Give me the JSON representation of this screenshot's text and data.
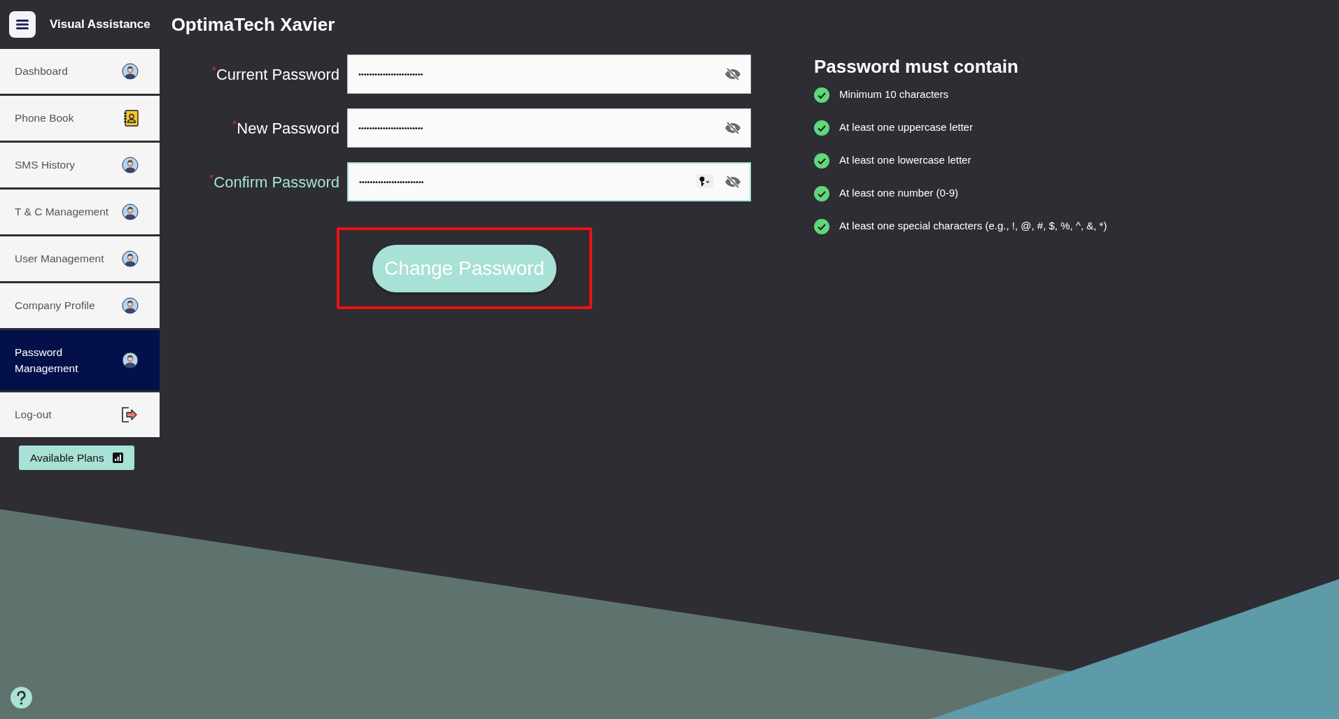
{
  "header": {
    "app_name": "Visual Assistance",
    "company": "OptimaTech Xavier"
  },
  "sidebar": {
    "items": [
      {
        "label": "Dashboard",
        "kind": "avatar",
        "selected": false
      },
      {
        "label": "Phone Book",
        "kind": "contacts",
        "selected": false
      },
      {
        "label": "SMS History",
        "kind": "avatar",
        "selected": false
      },
      {
        "label": "T & C Management",
        "kind": "avatar",
        "selected": false
      },
      {
        "label": "User Management",
        "kind": "avatar",
        "selected": false
      },
      {
        "label": "Company Profile",
        "kind": "avatar",
        "selected": false
      },
      {
        "label": "Password Management",
        "kind": "avatar",
        "selected": true
      },
      {
        "label": "Log-out",
        "kind": "logout",
        "selected": false
      }
    ],
    "plans_button": "Available Plans"
  },
  "form": {
    "fields": [
      {
        "required_mark": "*",
        "label": "Current Password",
        "value": "••••••••••••••••••••••••",
        "focused": false,
        "autofill_key": false
      },
      {
        "required_mark": "*",
        "label": "New Password",
        "value": "••••••••••••••••••••••••",
        "focused": false,
        "autofill_key": false
      },
      {
        "required_mark": "*",
        "label": "Confirm Password",
        "value": "••••••••••••••••••••••••",
        "focused": true,
        "autofill_key": true
      }
    ],
    "submit": {
      "label": "Change Password",
      "highlighted": true
    }
  },
  "requirements": {
    "title": "Password must contain",
    "items": [
      {
        "text": "Minimum 10 characters",
        "met": true
      },
      {
        "text": "At least one uppercase letter",
        "met": true
      },
      {
        "text": "At least one lowercase letter",
        "met": true
      },
      {
        "text": "At least one number (0-9)",
        "met": true
      },
      {
        "text": "At least one special characters (e.g., !, @, #, $, %, ^, &, *)",
        "met": true
      }
    ]
  }
}
